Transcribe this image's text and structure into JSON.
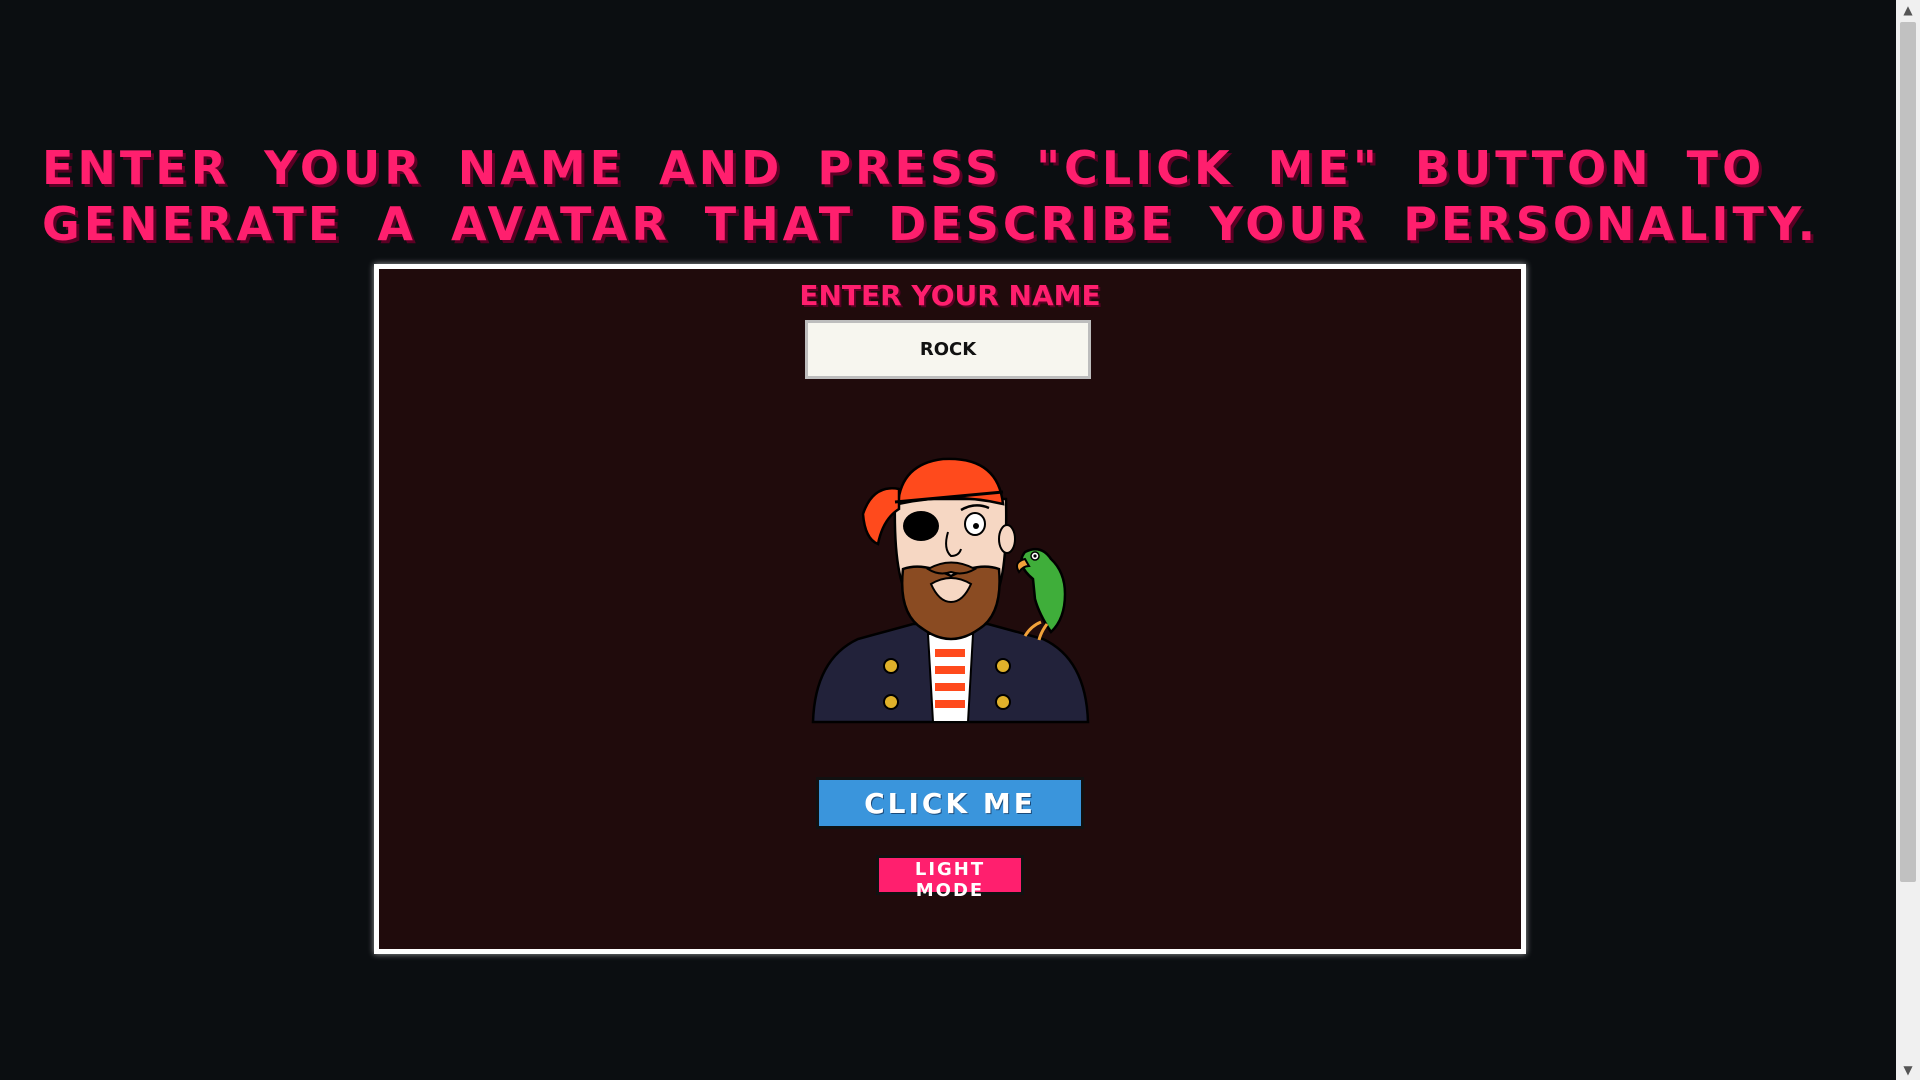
{
  "headline": "Enter your name and press \"Click me\" button to generate a avatar that describe your personality.",
  "form": {
    "name_label": "Enter Your Name",
    "name_value": "ROCK",
    "click_button": "CLICK ME",
    "mode_button": "LIGHT MODE"
  },
  "avatar": {
    "icon": "pirate-with-parrot"
  },
  "colors": {
    "background": "#0b0e11",
    "accent_pink": "#ff1f6e",
    "card_bg": "#200b0c",
    "button_blue": "#3a95dc"
  }
}
